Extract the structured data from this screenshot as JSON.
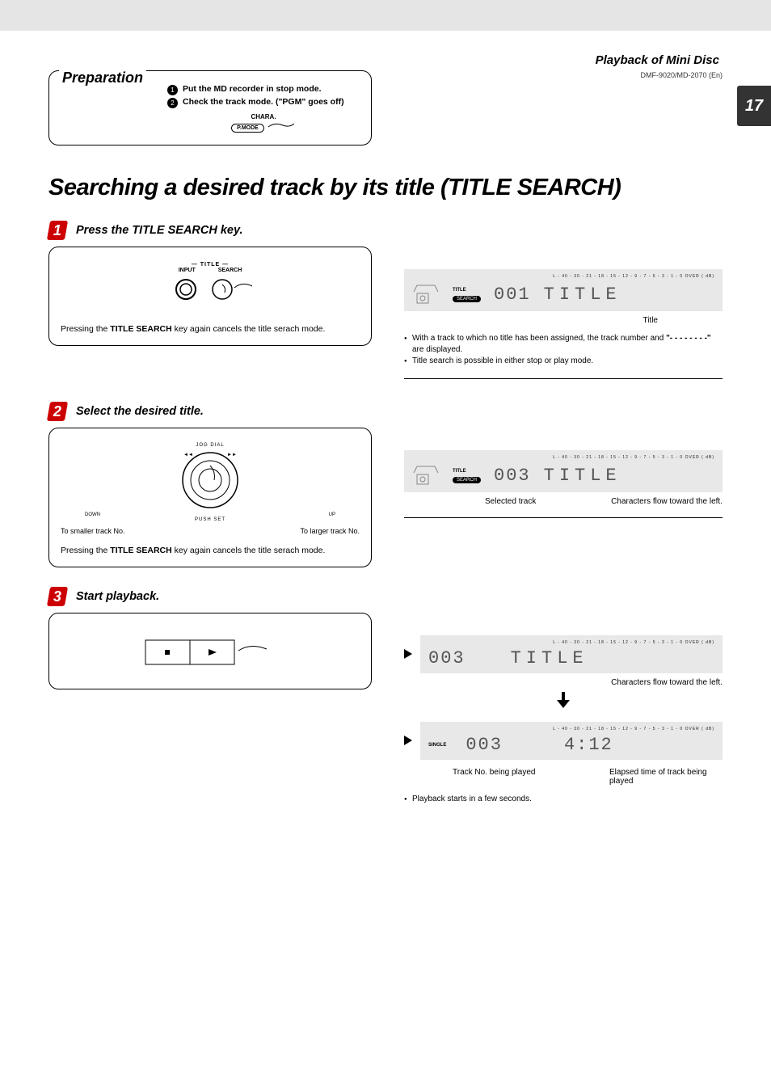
{
  "header": {
    "section_title": "Playback of Mini Disc",
    "model_code": "DMF-9020/MD-2070 (En)",
    "page_number": "17"
  },
  "preparation": {
    "title": "Preparation",
    "item1": "Put the MD recorder in stop mode.",
    "item2": "Check the track mode. (\"PGM\" goes off)",
    "chara_label": "CHARA.",
    "pmode_label": "P.MODE"
  },
  "main_title": "Searching a desired track by its title (TITLE SEARCH)",
  "step1": {
    "num": "1",
    "heading": "Press the TITLE SEARCH key.",
    "title_label": "TITLE",
    "input_label": "INPUT",
    "search_label": "SEARCH",
    "note_pre": "Pressing the ",
    "note_bold": "TITLE SEARCH",
    "note_post": " key again cancels the title serach mode.",
    "disp_title_badge": "TITLE",
    "disp_search_badge": "SEARCH",
    "disp_db": "L   - 40 - 30 - 21 - 18 - 15 - 12 - 9 - 7 - 5 - 3 - 1 - 0  OVER ( dB)",
    "disp_track": "001",
    "disp_text": "TITLE",
    "caption_title": "Title",
    "bullet1_pre": "With a track to which no title has been assigned, the track number and ",
    "bullet1_mid": "\"- - - - - - - -\"",
    "bullet1_post": " are displayed.",
    "bullet2": "Title search is possible in either stop or play mode."
  },
  "step2": {
    "num": "2",
    "heading": "Select the desired title.",
    "jog_label": "JOG DIAL",
    "down_lbl": "DOWN",
    "up_lbl": "UP",
    "pushset_lbl": "PUSH SET",
    "smaller": "To smaller track No.",
    "larger": "To larger track No.",
    "note_pre": "Pressing the ",
    "note_bold": "TITLE SEARCH",
    "note_post": " key again cancels the title serach mode.",
    "disp_title_badge": "TITLE",
    "disp_search_badge": "SEARCH",
    "disp_db": "L   - 40 - 30 - 21 - 18 - 15 - 12 - 9 - 7 - 5 - 3 - 1 - 0  OVER ( dB)",
    "disp_track": "003",
    "disp_text": "TITLE",
    "caption_sel": "Selected track",
    "caption_flow": "Characters flow toward the left."
  },
  "step3": {
    "num": "3",
    "heading": "Start playback.",
    "dispA_db": "L   - 40 - 30 - 21 - 18 - 15 - 12 - 9 - 7 - 5 - 3 - 1 - 0  OVER ( dB)",
    "dispA_track": "003",
    "dispA_text": "TITLE",
    "flow_caption": "Characters flow toward the left.",
    "dispB_db": "L   - 40 - 30 - 21 - 18 - 15 - 12 - 9 - 7 - 5 - 3 - 1 - 0  OVER ( dB)",
    "single_badge": "SINGLE",
    "dispB_track": "003",
    "dispB_time": "4:12",
    "caption_track": "Track No. being played",
    "caption_time": "Elapsed time of track being played",
    "bullet": "Playback starts in a few seconds."
  }
}
